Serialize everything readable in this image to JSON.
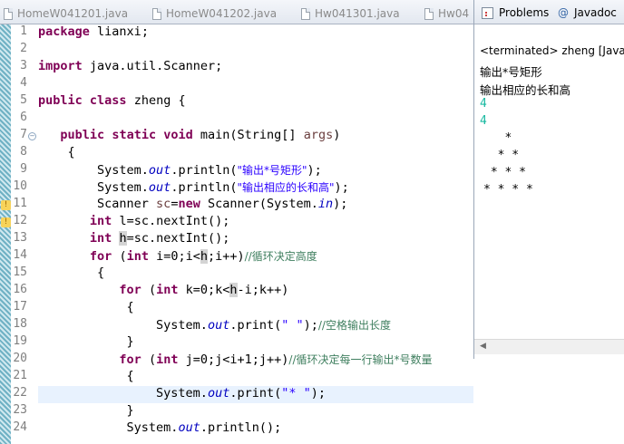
{
  "editor": {
    "tabs": [
      "HomeW041201.java",
      "HomeW041202.java",
      "Hw041301.java",
      "Hw04"
    ],
    "line_numbers": [
      "1",
      "2",
      "3",
      "4",
      "5",
      "6",
      "7",
      "8",
      "9",
      "10",
      "11",
      "12",
      "13",
      "14",
      "15",
      "16",
      "17",
      "18",
      "19",
      "20",
      "21",
      "22",
      "23",
      "24"
    ],
    "lines": [
      [
        [
          "kw",
          "package"
        ],
        [
          "",
          "lianxi;"
        ]
      ],
      [],
      [
        [
          "kw",
          "import"
        ],
        [
          "",
          "java.util.Scanner;"
        ]
      ],
      [],
      [
        [
          "kw",
          "public"
        ],
        [
          "",
          ""
        ],
        [
          "kw",
          "class"
        ],
        [
          "",
          "zheng {"
        ]
      ],
      [],
      [
        [
          "",
          "   "
        ],
        [
          "kw",
          "public"
        ],
        [
          "",
          ""
        ],
        [
          "kw",
          "static"
        ],
        [
          "",
          ""
        ],
        [
          "kw",
          "void"
        ],
        [
          "",
          "main(String[] "
        ],
        [
          "var",
          "args"
        ],
        [
          "",
          ")"
        ]
      ],
      [
        [
          "",
          "    {"
        ]
      ],
      [
        [
          "",
          "        System."
        ],
        [
          "fld",
          "out"
        ],
        [
          "",
          ".println("
        ],
        [
          "str",
          "\"输出*号矩形\""
        ],
        [
          "",
          ");"
        ]
      ],
      [
        [
          "",
          "        System."
        ],
        [
          "fld",
          "out"
        ],
        [
          "",
          ".println("
        ],
        [
          "str",
          "\"输出相应的长和高\""
        ],
        [
          "",
          ");"
        ]
      ],
      [
        [
          "",
          "        Scanner "
        ],
        [
          "var",
          "sc"
        ],
        [
          "",
          "="
        ],
        [
          "kw",
          "new"
        ],
        [
          "",
          "Scanner(System."
        ],
        [
          "fld",
          "in"
        ],
        [
          "",
          ");"
        ]
      ],
      [
        [
          "",
          "       "
        ],
        [
          "kw",
          "int"
        ],
        [
          "",
          "l=sc.nextInt();"
        ]
      ],
      [
        [
          "",
          "       "
        ],
        [
          "kw",
          "int"
        ],
        [
          "mark",
          "h"
        ],
        [
          "",
          "=sc.nextInt();"
        ]
      ],
      [
        [
          "",
          "       "
        ],
        [
          "kw",
          "for"
        ],
        [
          "",
          "("
        ],
        [
          "kw",
          "int"
        ],
        [
          "",
          "i=0;i<"
        ],
        [
          "mark",
          "h"
        ],
        [
          "",
          ";i++)"
        ],
        [
          "cmt",
          "//循环决定高度"
        ]
      ],
      [
        [
          "",
          "        {"
        ]
      ],
      [
        [
          "",
          "           "
        ],
        [
          "kw",
          "for"
        ],
        [
          "",
          "("
        ],
        [
          "kw",
          "int"
        ],
        [
          "",
          "k=0;k<"
        ],
        [
          "mark",
          "h"
        ],
        [
          "",
          "-i;k++)"
        ]
      ],
      [
        [
          "",
          "            {"
        ]
      ],
      [
        [
          "",
          "                System."
        ],
        [
          "fld",
          "out"
        ],
        [
          "",
          ".print("
        ],
        [
          "str",
          "\" \""
        ],
        [
          "",
          ");"
        ],
        [
          "cmt",
          "//空格输出长度"
        ]
      ],
      [
        [
          "",
          "            }"
        ]
      ],
      [
        [
          "",
          "           "
        ],
        [
          "kw",
          "for"
        ],
        [
          "",
          "("
        ],
        [
          "kw",
          "int"
        ],
        [
          "",
          "j=0;j<i+1;j++)"
        ],
        [
          "cmt",
          "//循环决定每一行输出*号数量"
        ]
      ],
      [
        [
          "",
          "            {"
        ]
      ],
      [
        [
          "",
          "                System."
        ],
        [
          "fld",
          "out"
        ],
        [
          "",
          ".print("
        ],
        [
          "str",
          "\"* \""
        ],
        [
          "",
          ");"
        ]
      ],
      [
        [
          "",
          "            }"
        ]
      ],
      [
        [
          "",
          "            System."
        ],
        [
          "fld",
          "out"
        ],
        [
          "",
          ".println();"
        ]
      ]
    ],
    "current_line": 22
  },
  "console": {
    "tabs": [
      "Problems",
      "Javadoc"
    ],
    "status": "<terminated> zheng [Java Application]",
    "output": [
      "输出*号矩形",
      "输出相应的长和高"
    ],
    "inputs": [
      "4",
      "4"
    ],
    "stars": [
      "   *",
      "  * *",
      " * * *",
      "* * * *"
    ]
  },
  "icons": {
    "file": "java-file-icon",
    "problems": "problems-icon",
    "javadoc": "javadoc-at-icon",
    "warning": "warning-icon",
    "fold": "fold-collapse-icon",
    "scroll_left": "scroll-left-arrow-icon"
  },
  "colors": {
    "keyword": "#7f0055",
    "string": "#2a00ff",
    "static_field": "#0000c0",
    "comment": "#3f7f5f",
    "local_var": "#6a3e3e",
    "console_input": "#17b8a0",
    "current_line": "#e8f2fe"
  }
}
